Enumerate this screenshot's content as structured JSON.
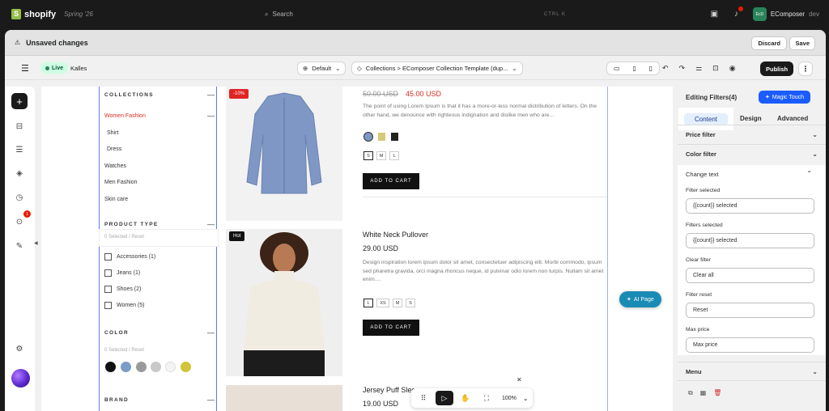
{
  "topbar": {
    "brand": "shopify",
    "edition": "Spring '26",
    "search_label": "Search",
    "shortcut": "CTRL  K",
    "store_initials": "EcD",
    "store_name": "EComposer",
    "store_env": "dev"
  },
  "unsaved": {
    "message": "Unsaved changes",
    "discard_label": "Discard",
    "save_label": "Save"
  },
  "editor_bar": {
    "status": "Live",
    "theme": "Kalles",
    "locale": "Default",
    "template": "Collections > EComposer Collection Template (dup...",
    "publish_label": "Publish"
  },
  "filters": {
    "collections_title": "COLLECTIONS",
    "collections": [
      "Women Fashion",
      "Shirt",
      "Dress",
      "Watches",
      "Men Fashion",
      "Skin care"
    ],
    "product_type_title": "PRODUCT TYPE",
    "selected_text": "0 Selected   /    Reset",
    "types": [
      "Accessories (1)",
      "Jeans (1)",
      "Shoes (2)",
      "Women (5)"
    ],
    "color_title": "COLOR",
    "color_selected_text": "0 Selected   /    Reset",
    "color_swatches": [
      "#111111",
      "#7a9cc6",
      "#9a9a9a",
      "#c8c8c8",
      "#f4f4f4",
      "#cfc43a"
    ],
    "brand_title": "BRAND"
  },
  "products": [
    {
      "badge": "-10%",
      "old_price": "50.00 USD",
      "price": "45.00 USD",
      "description": "The point of using Lorem Ipsum is that it has a more-or-less normal distribution of letters. On the other hand, we denounce with righteous indignation and dislike men who are...",
      "sizes": [
        "S",
        "M",
        "L"
      ],
      "cart_label": "ADD TO CART"
    },
    {
      "badge": "Hot",
      "title": "White Neck Pullover",
      "price": "29.00 USD",
      "description": "Design inspiration lorem ipsum dolor sit amet, consectetuer adipiscing elit. Morbi commodo, ipsum sed pharetra gravida, orci magna rhoncus neque, id pulvinar odio lorem non turpis. Nullam sit amet enim....",
      "sizes": [
        "L",
        "XS",
        "M",
        "S"
      ],
      "cart_label": "ADD TO CART"
    },
    {
      "title": "Jersey Puff Sleeve",
      "price": "19.00 USD"
    }
  ],
  "ai_page_label": "AI Page",
  "zoom": "100%",
  "notification_count": "1",
  "panel": {
    "title": "Editing Filters(4)",
    "magic_touch": "Magic Touch",
    "tabs": [
      "Content",
      "Design",
      "Advanced"
    ],
    "sections": [
      "Price filter",
      "Color filter",
      "Change text",
      "Menu"
    ],
    "fields": [
      {
        "label": "Filter selected",
        "value": "{{count}} selected"
      },
      {
        "label": "Filters selected",
        "value": "{{count}} selected"
      },
      {
        "label": "Clear filter",
        "value": "Clear all"
      },
      {
        "label": "Filter reset",
        "value": "Reset"
      },
      {
        "label": "Max price",
        "value": "Max price"
      }
    ]
  }
}
